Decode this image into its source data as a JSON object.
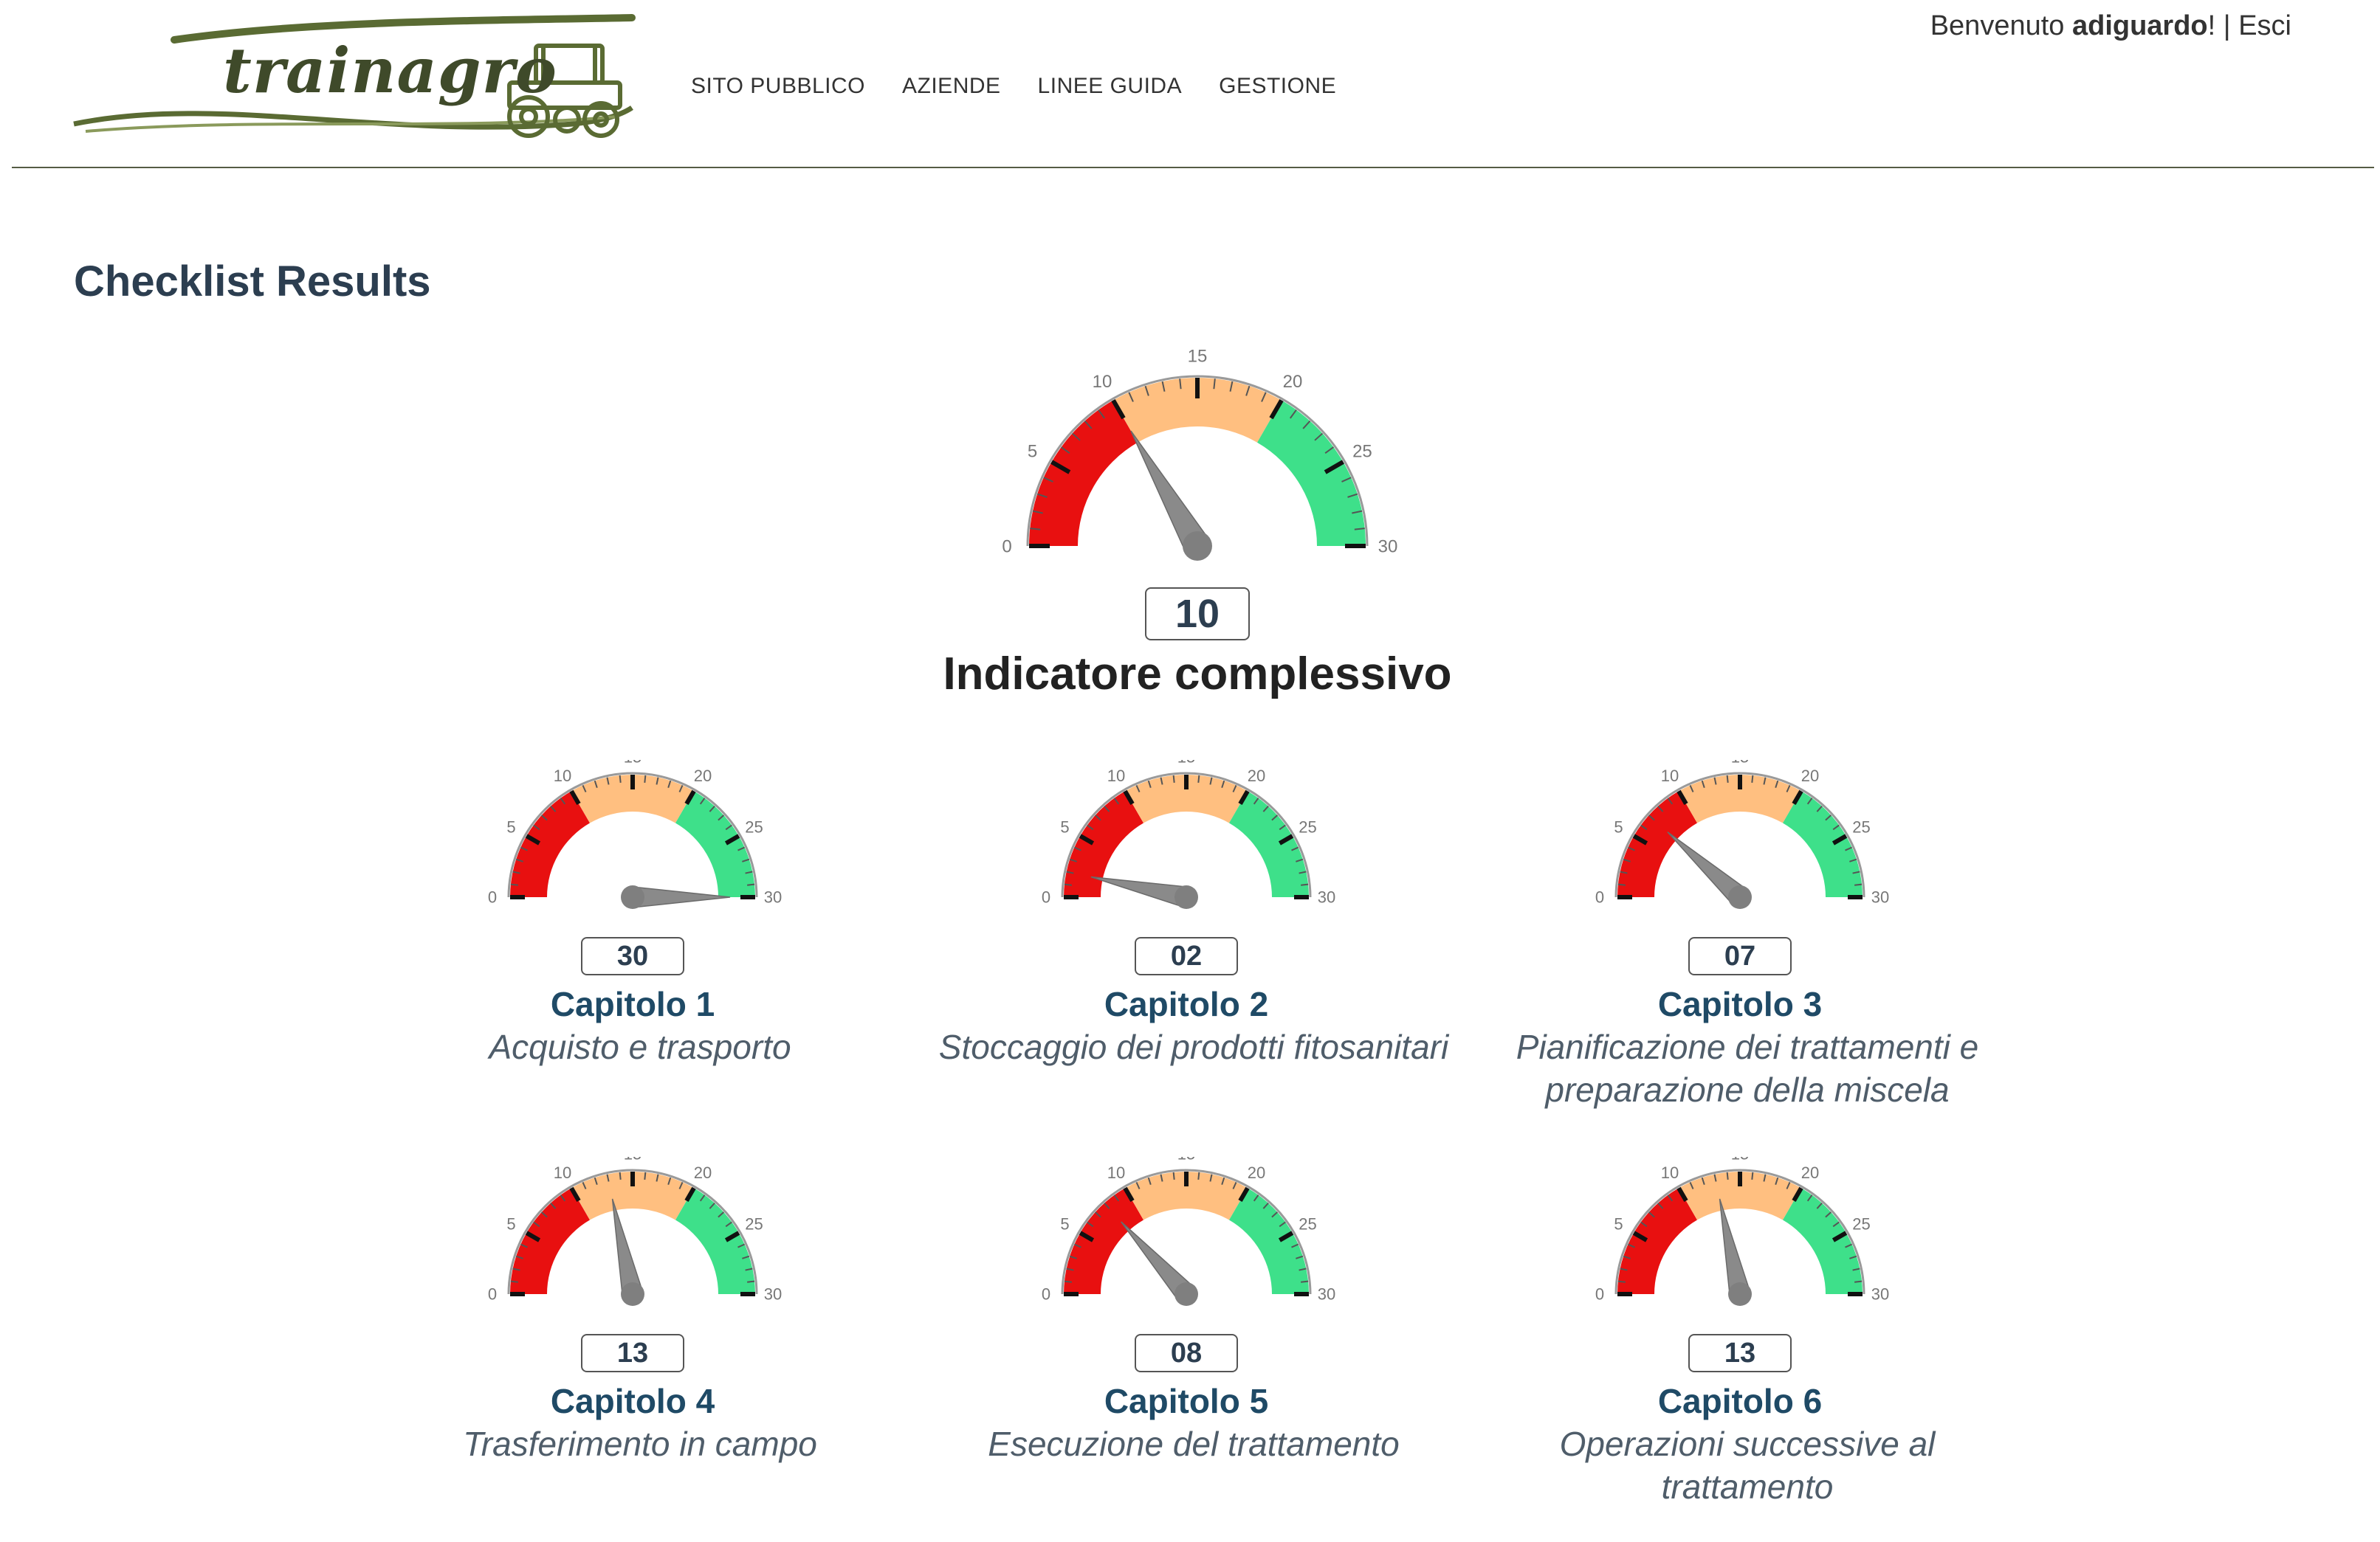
{
  "header": {
    "logo_text": "trainagro",
    "nav": [
      "SITO PUBBLICO",
      "AZIENDE",
      "LINEE GUIDA",
      "GESTIONE"
    ],
    "welcome_prefix": "Benvenuto ",
    "username": "adiguardo",
    "welcome_suffix": "! | ",
    "logout_label": "Esci"
  },
  "page_title": "Checklist Results",
  "gauge_scale": {
    "min": 0,
    "max": 30,
    "tick_labels": [
      "0",
      "5",
      "10",
      "15",
      "20",
      "25",
      "30"
    ],
    "bands": [
      {
        "from": 0,
        "to": 10,
        "color": "#e81010"
      },
      {
        "from": 10,
        "to": 20,
        "color": "#ffbf80"
      },
      {
        "from": 20,
        "to": 30,
        "color": "#3ee08a"
      }
    ],
    "needle_color": "#8a8a8a"
  },
  "overall": {
    "value": 10,
    "value_label": "10",
    "title": "Indicatore complessivo"
  },
  "chapters": [
    {
      "value": 30,
      "value_label": "30",
      "title": "Capitolo 1",
      "subtitle": "Acquisto e trasporto"
    },
    {
      "value": 2,
      "value_label": "02",
      "title": "Capitolo 2",
      "subtitle": "Stoccaggio dei prodotti fitosanitari"
    },
    {
      "value": 7,
      "value_label": "07",
      "title": "Capitolo 3",
      "subtitle": "Pianificazione dei trattamenti e preparazione della miscela"
    },
    {
      "value": 13,
      "value_label": "13",
      "title": "Capitolo 4",
      "subtitle": "Trasferimento in campo"
    },
    {
      "value": 8,
      "value_label": "08",
      "title": "Capitolo 5",
      "subtitle": "Esecuzione del trattamento"
    },
    {
      "value": 13,
      "value_label": "13",
      "title": "Capitolo 6",
      "subtitle": "Operazioni successive al trattamento"
    }
  ]
}
